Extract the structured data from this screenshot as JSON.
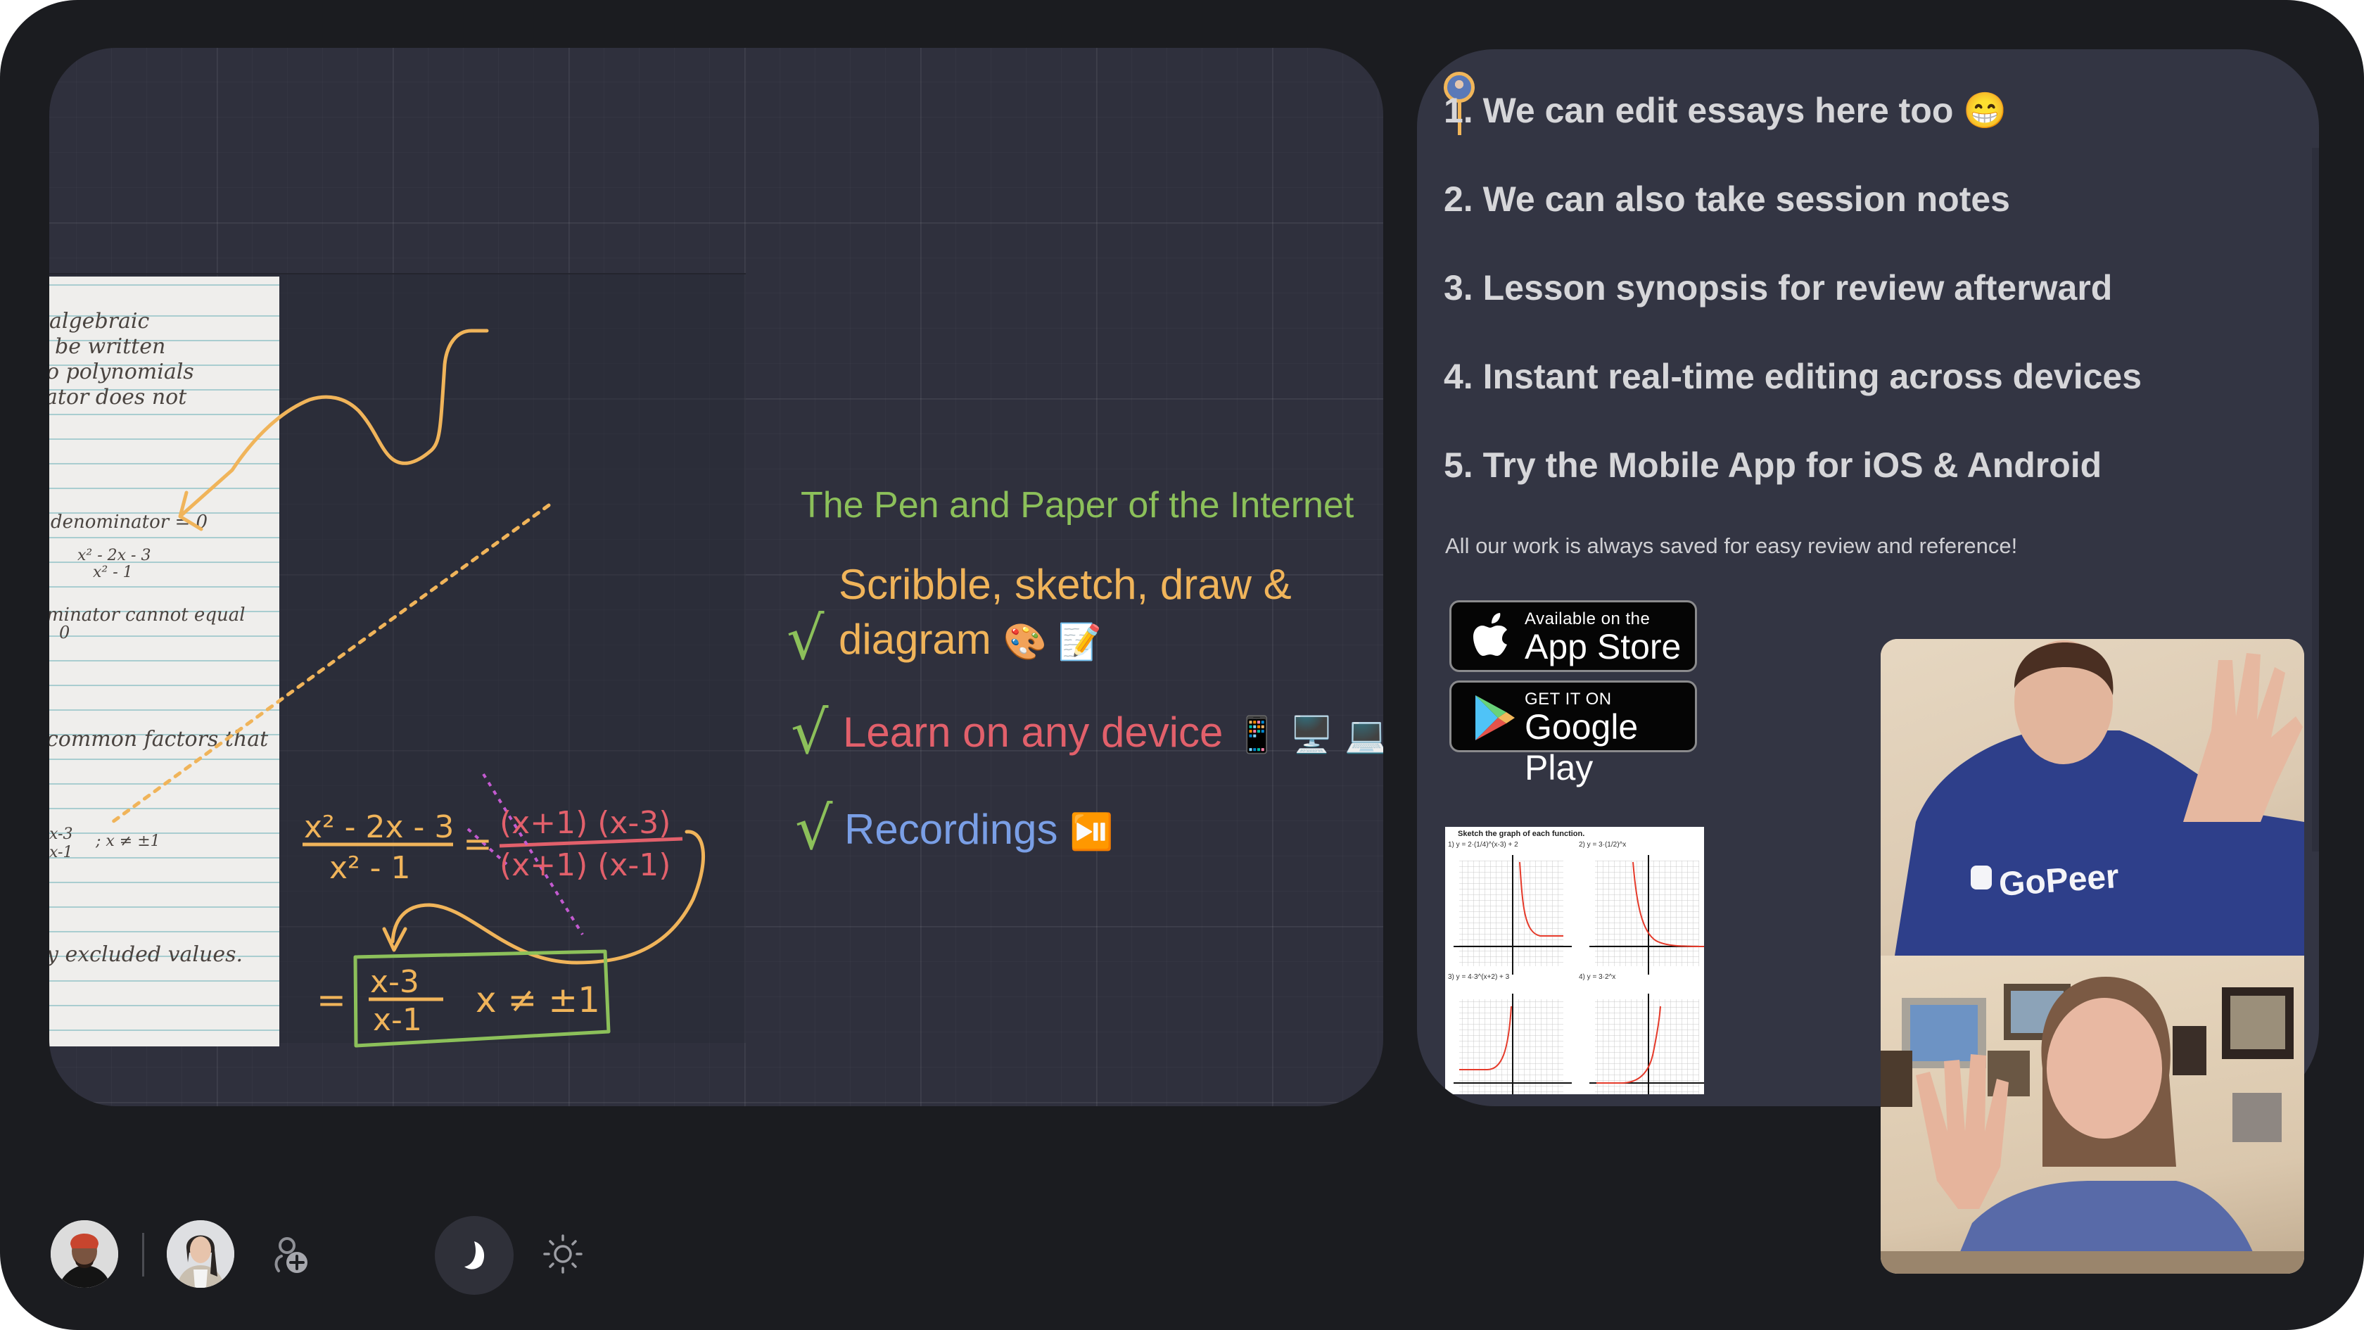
{
  "whiteboard": {
    "paper_notes": [
      "algebraic",
      "be written",
      "o polynomials",
      "ator does not",
      "denominator = 0",
      "x² - 2x - 3",
      "x² - 1",
      "minator cannot equal",
      "0",
      "common factors that",
      "x-3",
      "x-1",
      "; x ≠ ±1",
      "y excluded values."
    ],
    "handwritten_math": {
      "lhs_numerator": "x² - 2x - 3",
      "lhs_denominator": "x² - 1",
      "factored_numerator": "(x+1) (x-3)",
      "factored_denominator": "(x+1) (x-1)",
      "result_numerator": "x-3",
      "result_denominator": "x-1",
      "result_condition": "x ≠ ±1",
      "equals": "="
    },
    "title": "The Pen and Paper of the Internet",
    "check": "√",
    "items": [
      {
        "text": "Scribble, sketch, draw &",
        "text2": "diagram",
        "emoji": "🎨 📝",
        "color": "#f0b45a"
      },
      {
        "text": "Learn on any device",
        "emoji": "📱 🖥️ 💻",
        "color": "#e2606b"
      },
      {
        "text": "Recordings",
        "emoji": "⏯️",
        "color": "#7a9fe6"
      }
    ]
  },
  "notes": {
    "lines": [
      "1. We can edit essays here too 😁",
      "2. We can also take session notes",
      "3. Lesson synopsis for review afterward",
      "4. Instant real-time editing across devices",
      "5. Try the Mobile App for iOS & Android"
    ],
    "subtitle": "All our work is always saved for easy review and reference!",
    "app_store": {
      "small": "Available on the",
      "big": "App Store"
    },
    "google_play": {
      "small": "GET IT ON",
      "big": "Google Play"
    },
    "worksheet": {
      "title": "Sketch the graph of each function.",
      "problems": [
        "1)  y = 2·(1/4)^(x-3) + 2",
        "2)  y = 3·(1/2)^x",
        "3)  y = 4·3^(x+2) + 3",
        "4)  y = 3·2^x"
      ]
    }
  },
  "video": {
    "shirt_text": "GoPeer"
  },
  "toolbar": {
    "participants": [
      "participant-1",
      "participant-2"
    ],
    "add_participant": "add-participant",
    "theme_dark": "dark-theme",
    "theme_light": "light-theme"
  },
  "colors": {
    "frame": "#1b1c20",
    "canvas": "#2f303d",
    "notes_panel": "#333543",
    "accent_orange": "#f0b45a",
    "accent_green": "#8cc05a",
    "accent_red": "#e2606b",
    "accent_blue": "#7a9fe6",
    "accent_purple": "#c35ad0"
  }
}
